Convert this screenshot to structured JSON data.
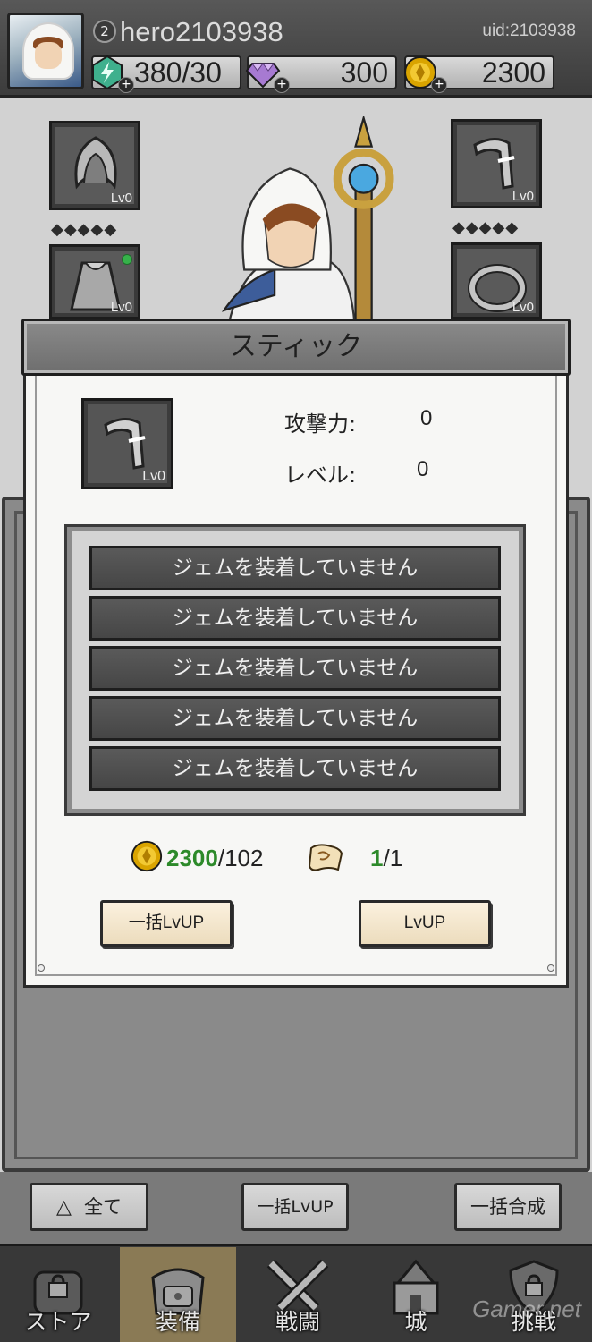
{
  "header": {
    "player_level": "2",
    "player_name": "hero2103938",
    "uid": "uid:2103938",
    "energy": "380/30",
    "gems": "300",
    "coins": "2300",
    "plus_symbol": "+"
  },
  "equipment": {
    "slot_hood_lv": "Lv0",
    "slot_weapon_lv": "Lv0",
    "slot_cloak_lv": "Lv0",
    "slot_ring_lv": "Lv0",
    "gem_diamonds": "◆◆◆◆◆"
  },
  "modal": {
    "title": "スティック",
    "item_lv": "Lv0",
    "attack_label": "攻撃力:",
    "attack_value": "0",
    "level_label": "レベル:",
    "level_value": "0",
    "gem_slots": [
      "ジェムを装着していません",
      "ジェムを装着していません",
      "ジェムを装着していません",
      "ジェムを装着していません",
      "ジェムを装着していません"
    ],
    "coin_have": "2300",
    "coin_need": "/102",
    "scroll_have": "1",
    "scroll_need": "/1",
    "bulk_lvup_button": "一括LvUP",
    "lvup_button": "LvUP"
  },
  "actions": {
    "filter_button": "全て",
    "filter_icon": "△",
    "bulk_lvup_button": "一括LvUP",
    "bulk_merge_button": "一括合成"
  },
  "nav": {
    "store": "ストア",
    "equip": "装備",
    "battle": "戦闘",
    "castle": "城",
    "challenge": "挑戦"
  },
  "watermark": "Gamer.net",
  "colors": {
    "highlight_green": "#2d8a2a",
    "button_tan": "#f3e6cb",
    "coin_gold": "#d9a400"
  }
}
